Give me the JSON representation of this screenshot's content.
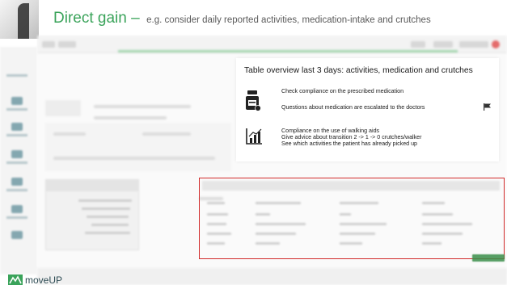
{
  "slide": {
    "title": "Direct gain –",
    "subtitle": "e.g. consider daily reported activities, medication-intake and crutches"
  },
  "card": {
    "title": "Table overview last 3 days: activities, medication and crutches",
    "medication": {
      "icon": "pill-bottle-icon",
      "line1": "Check compliance on the prescribed medication",
      "line2": "Questions about medication are escalated to the doctors",
      "flag_icon": "flag-icon"
    },
    "walking_aids": {
      "icon": "bar-chart-icon",
      "line1": "Compliance on the use of walking aids",
      "line2": "Give advice about transition 2 -> 1 -> 0 crutches/walker",
      "line3": "See which activities the patient has already picked up"
    }
  },
  "highlight": {
    "color": "#d12a2a"
  },
  "brand": {
    "logo_text": "moveUP",
    "accent": "#3aa35a"
  }
}
